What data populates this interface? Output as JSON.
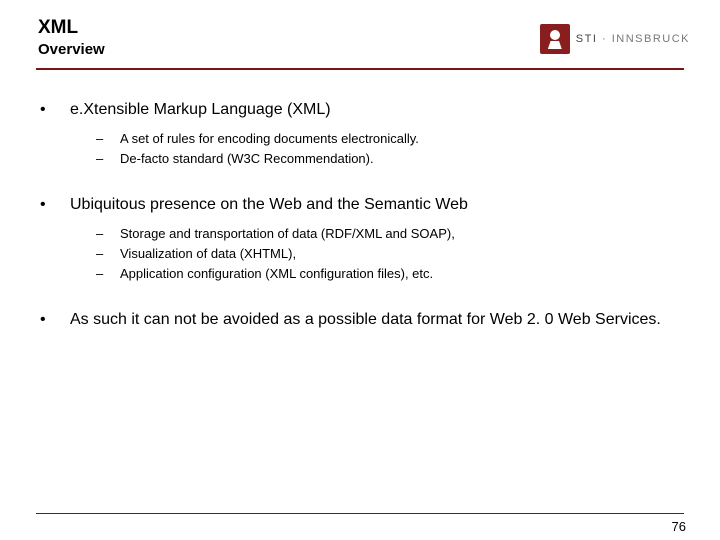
{
  "header": {
    "title": "XML",
    "subtitle": "Overview"
  },
  "logo": {
    "text_main": "STI",
    "text_sub": "INNSBRUCK",
    "sep": " · "
  },
  "bullets": [
    {
      "text": "e.Xtensible Markup Language (XML)",
      "sub": [
        "A set of rules for encoding documents electronically.",
        "De-facto standard (W3C Recommendation)."
      ]
    },
    {
      "text": "Ubiquitous presence on the Web and the Semantic Web",
      "sub": [
        "Storage and transportation of data (RDF/XML and SOAP),",
        "Visualization of data (XHTML),",
        "Application configuration (XML configuration files), etc."
      ]
    },
    {
      "text": "As such it can not be avoided as a possible data format for Web 2. 0 Web Services.",
      "sub": []
    }
  ],
  "page_number": "76"
}
